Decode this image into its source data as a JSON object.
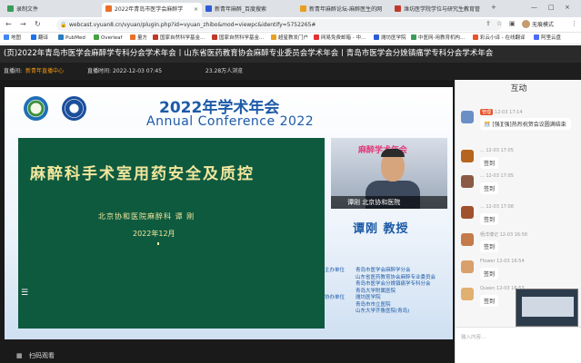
{
  "browser": {
    "tabs": [
      {
        "title": "录制文件",
        "favicon": "#3b9c5a",
        "active": false
      },
      {
        "title": "2022年青岛市医学会麻醉学",
        "favicon": "#e8702a",
        "active": true
      },
      {
        "title": "新青年麻醉_百度搜索",
        "favicon": "#2e5bd6",
        "active": false
      },
      {
        "title": "新青年麻醉论坛-麻醉医生的网",
        "favicon": "#e8a020",
        "active": false
      },
      {
        "title": "潍坊医学院学位与研究生教育管",
        "favicon": "#c0392b",
        "active": false
      }
    ],
    "new_tab": "+",
    "url": "webcast.vyuan8.cn/vyuan/plugin.php?id=vyuan_zhibo&mod=viewpc&identify=5752265#",
    "profile": "无痕模式",
    "bookmarks": [
      {
        "label": "地图",
        "color": "#4285f4"
      },
      {
        "label": "翻译",
        "color": "#1a73e8"
      },
      {
        "label": "PubMed",
        "color": "#2a7bc0"
      },
      {
        "label": "Overleaf",
        "color": "#47a141"
      },
      {
        "label": "量方",
        "color": "#e8702a"
      },
      {
        "label": "国家自然科学基金...",
        "color": "#c0392b"
      },
      {
        "label": "国家自然科学基金...",
        "color": "#c0392b"
      },
      {
        "label": "超星教发门户",
        "color": "#e8a020"
      },
      {
        "label": "网易免费邮箱 - 中...",
        "color": "#d33"
      },
      {
        "label": "潍坊医学院",
        "color": "#2e5bd6"
      },
      {
        "label": "中医网-用教育机构...",
        "color": "#3b9c5a"
      },
      {
        "label": "彩云小译 - 在线翻译",
        "color": "#e8532b"
      },
      {
        "label": "阿里云盘",
        "color": "#4a6cf7"
      }
    ]
  },
  "page": {
    "title": "(页)2022年青岛市医学会麻醉学专科分会学术年会丨山东省医药教育协会麻醉专业委员会学术年会丨青岛市医学会分娩镇痛学专科分会学术年会",
    "host_label": "直播间:",
    "host_value": "新青年直播中心",
    "time_label": "直播时间:",
    "time_value": "2022-12-03 07:45",
    "views": "23.28万人浏览"
  },
  "slide": {
    "conf_cn": "2022年学术年会",
    "conf_en": "Annual Conference 2022",
    "talk_title": "麻醉科手术室用药安全及质控",
    "talk_sub": "北京协和医院麻醉科   谭 刚",
    "talk_date": "2022年12月",
    "camera_label": "谭刚 北京协和医院",
    "camera_banner": "麻醉学术年会",
    "speaker": "谭刚  教授",
    "units_label": "主办单位",
    "units_cohost_label": "协办单位",
    "units": [
      "青岛市医学会麻醉学分会",
      "山东省医药教育协会麻醉专业委员会",
      "青岛市医学会分娩镇痛学专科分会",
      "青岛大学附属医院",
      "潍坊医学院",
      "青岛市市立医院",
      "山东大学齐鲁医院(青岛)"
    ]
  },
  "player": {
    "scan": "扫码观看"
  },
  "sidebar": {
    "title": "互动",
    "messages": [
      {
        "user": "管理",
        "time": "12-03 17:14",
        "text": "🎊 [强][强]热烈祝贺会议圆满结束",
        "badge": "管理",
        "avatar": "#6a8fc7"
      },
      {
        "user": "...",
        "time": "12-03 17:05",
        "text": "签到",
        "avatar": "#b5651d"
      },
      {
        "user": "...",
        "time": "12-03 17:05",
        "text": "签到",
        "avatar": "#8a5a44"
      },
      {
        "user": "...",
        "time": "12-03 17:08",
        "text": "签到",
        "avatar": "#a0522d"
      },
      {
        "user": "杨洋博记",
        "time": "12-03 16:56",
        "text": "签到",
        "avatar": "#c47a4a"
      },
      {
        "user": "Flower",
        "time": "12-03 16:54",
        "text": "签到",
        "avatar": "#d9a06b"
      },
      {
        "user": "Queen",
        "time": "12-03 16:53",
        "text": "签到",
        "avatar": "#e0b070"
      }
    ],
    "input_placeholder": "输入内容..."
  }
}
